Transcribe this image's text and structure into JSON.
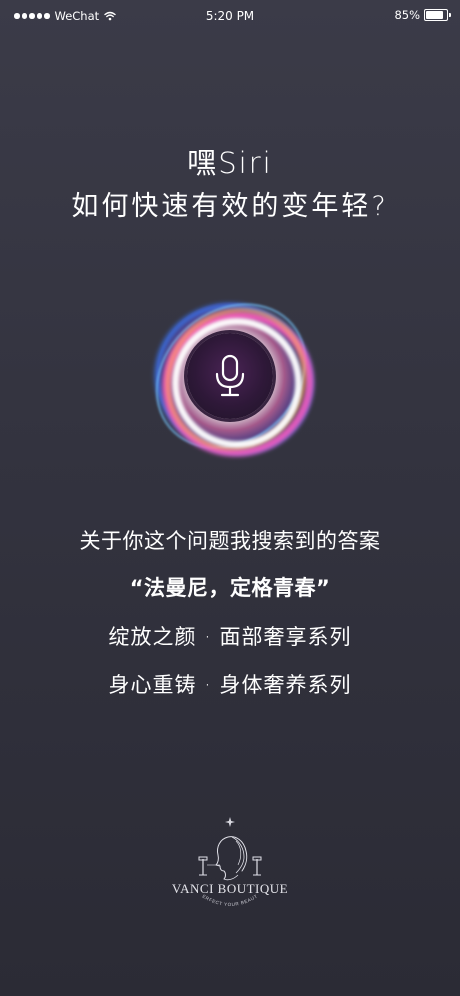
{
  "status_bar": {
    "carrier": "WeChat",
    "time": "5:20 PM",
    "battery_text": "85%",
    "battery_level": 0.85
  },
  "headline": {
    "line1": "嘿Siri",
    "line2": "如何快速有效的变年轻?"
  },
  "orb": {
    "icon": "microphone-icon"
  },
  "answer": {
    "intro": "关于你这个问题我搜索到的答案",
    "brand_quote": "“法曼尼，定格青春”",
    "series_1": "绽放之颜 · 面部奢享系列",
    "series_2": "身心重铸 · 身体奢养系列"
  },
  "logo": {
    "name": "VANCI BOUTIQUE",
    "tagline": "PERFECT YOUR BEAUTY"
  },
  "colors": {
    "background_top": "#3b3b48",
    "background_bottom": "#2b2b35",
    "text": "#ffffff",
    "orb_pink": "#ff5abe",
    "orb_blue": "#3c78ff",
    "orb_core": "#2e1838"
  }
}
